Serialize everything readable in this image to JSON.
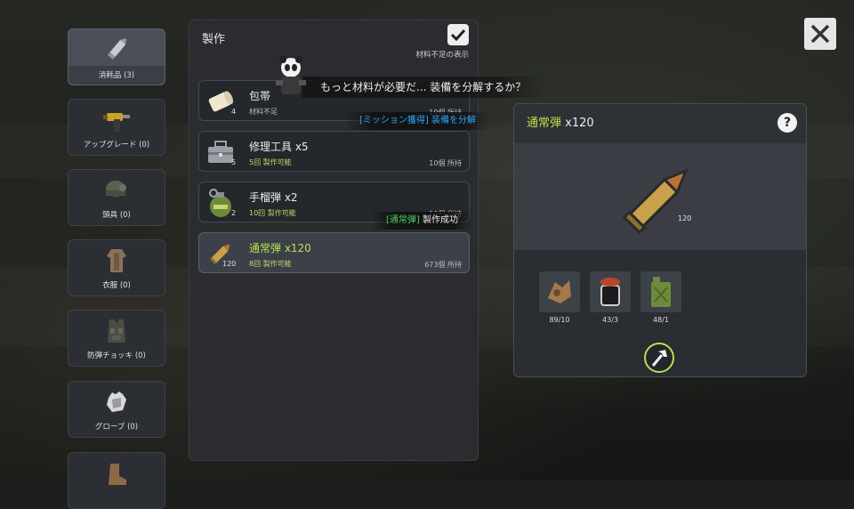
{
  "sidebar": {
    "items": [
      {
        "label": "消耗品 (3)",
        "icon": "bullet-icon",
        "active": true
      },
      {
        "label": "アップグレード (0)",
        "icon": "drill-icon"
      },
      {
        "label": "頭具 (0)",
        "icon": "helmet-icon"
      },
      {
        "label": "衣服 (0)",
        "icon": "clothing-icon"
      },
      {
        "label": "防弾チョッキ (0)",
        "icon": "vest-icon"
      },
      {
        "label": "グローブ (0)",
        "icon": "glove-icon"
      },
      {
        "label": "",
        "icon": "boots-icon"
      }
    ]
  },
  "craft_panel": {
    "title": "製作",
    "toggle_label": "材料不足の表示",
    "toggle_checked": true,
    "items": [
      {
        "name": "包帯",
        "qty": "4",
        "status": "材料不足",
        "owned": "19個 所持",
        "icon": "bandage-icon"
      },
      {
        "name": "修理工具 x5",
        "qty": "5",
        "status": "5回 製作可能",
        "owned": "10個 所持",
        "icon": "toolbox-icon"
      },
      {
        "name": "手榴弾 x2",
        "qty": "2",
        "status": "10回 製作可能",
        "owned": "10個 所持",
        "icon": "grenade-icon"
      },
      {
        "name": "通常弾 x120",
        "qty": "120",
        "status": "8回 製作可能",
        "owned": "673個 所持",
        "icon": "bullet-icon",
        "selected": true
      }
    ]
  },
  "messages": {
    "dialog": "もっと材料が必要だ... 装備を分解するか？",
    "notice1_tag": "[ミッション獲得]",
    "notice1_text": "装備を分解",
    "notice2_tag": "[通常弾]",
    "notice2_text": "製作成功"
  },
  "detail": {
    "title": "通常弾",
    "title_qty": "x120",
    "help": "?",
    "art_qty": "120",
    "materials": [
      {
        "icon": "scrap-metal-icon",
        "count": "89/10"
      },
      {
        "icon": "gunpowder-jar-icon",
        "count": "43/3"
      },
      {
        "icon": "jerrycan-icon",
        "count": "48/1"
      }
    ],
    "craft_button_icon": "hammer-icon"
  },
  "colors": {
    "accent_green": "#b9e04a",
    "notice_blue": "#2aa8ff",
    "notice_green": "#4cd15e"
  }
}
